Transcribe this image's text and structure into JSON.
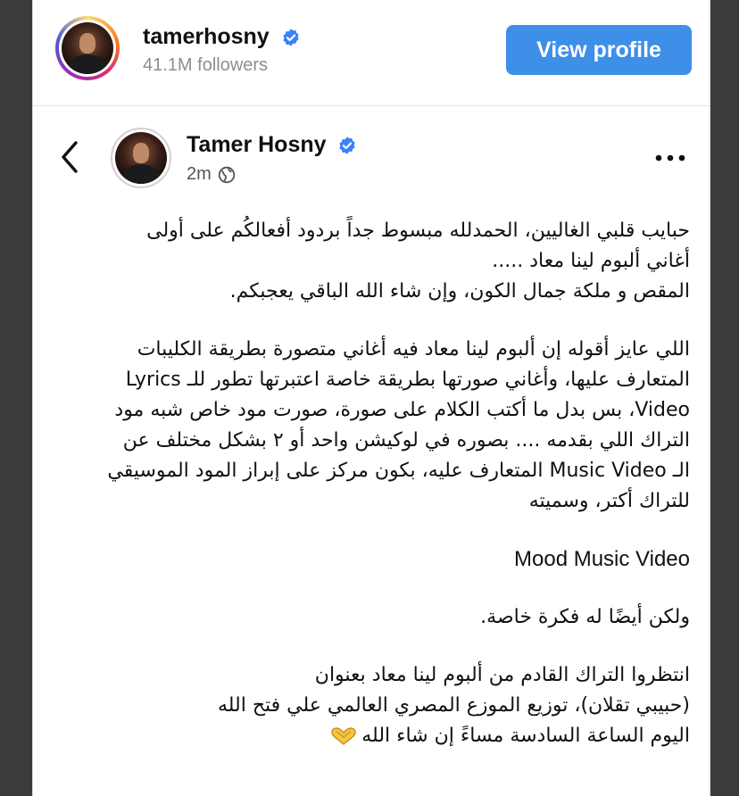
{
  "header": {
    "username": "tamerhosny",
    "followers": "41.1M followers",
    "view_profile_label": "View profile"
  },
  "post": {
    "author_name": "Tamer Hosny",
    "time": "2m",
    "paragraphs": [
      [
        "حبايب قلبي الغاليين، الحمدلله مبسوط جداً بردود أفعالكُم على أولى",
        "أغاني ألبوم لينا معاد .....",
        "المقص و ملكة جمال الكون، وإن شاء الله الباقي يعجبكم."
      ],
      [
        "اللي عايز أقوله إن ألبوم لينا معاد فيه أغاني متصورة بطريقة الكليبات",
        "المتعارف عليها، وأغاني صورتها بطريقة خاصة اعتبرتها تطور للـ Lyrics",
        "Video، بس بدل ما أكتب الكلام على صورة، صورت مود خاص شبه مود",
        "التراك اللي بقدمه .... بصوره في لوكيشن واحد أو ٢ بشكل مختلف عن",
        "الـ Music Video المتعارف عليه، بكون مركز على إبراز المود الموسيقي",
        "للتراك أكتر، وسميته"
      ],
      [
        "Mood Music Video"
      ],
      [
        "ولكن أيضًا له فكرة خاصة."
      ],
      [
        "انتظروا التراك القادم من ألبوم لينا معاد بعنوان",
        "(حبيبي تقلان)، توزيع الموزع المصري العالمي علي فتح الله",
        "اليوم الساعة السادسة مساءً إن شاء الله"
      ]
    ]
  },
  "icons": {
    "verified": "verified-badge-icon",
    "back": "chevron-left-icon",
    "globe": "globe-icon",
    "more": "more-options-icon",
    "heart_hands": "heart-hands-emoji"
  },
  "colors": {
    "accent": "#3d8fe8",
    "verified": "#3b82f6",
    "muted": "#8e8e8e"
  }
}
